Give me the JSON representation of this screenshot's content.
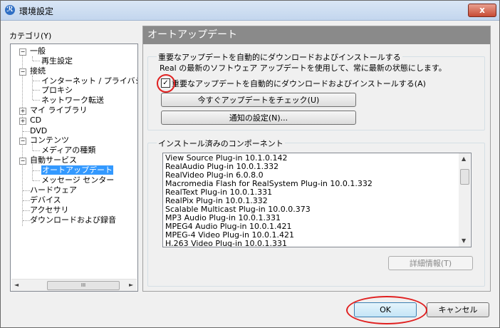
{
  "window": {
    "title": "環境設定",
    "close_label": "x"
  },
  "category_label": "カテゴリ(Y)",
  "tree": [
    {
      "label": "一般",
      "expander": "−"
    },
    {
      "label": "再生設定"
    },
    {
      "label": "接続",
      "expander": "−"
    },
    {
      "label": "インターネット / プライバシー"
    },
    {
      "label": "プロキシ"
    },
    {
      "label": "ネットワーク転送"
    },
    {
      "label": "マイ ライブラリ",
      "expander": "+"
    },
    {
      "label": "CD",
      "expander": "+"
    },
    {
      "label": "DVD"
    },
    {
      "label": "コンテンツ",
      "expander": "−"
    },
    {
      "label": "メディアの種類"
    },
    {
      "label": "自動サービス",
      "expander": "−"
    },
    {
      "label": "オートアップデート"
    },
    {
      "label": "メッセージ センター"
    },
    {
      "label": "ハードウェア"
    },
    {
      "label": "デバイス"
    },
    {
      "label": "アクセサリ"
    },
    {
      "label": "ダウンロードおよび録音"
    }
  ],
  "hscroll": {
    "left": "◄",
    "right": "►",
    "grip": "III"
  },
  "panel": {
    "header": "オートアップデート",
    "update_group": {
      "title": "重要なアップデートを自動的にダウンロードおよびインストールする",
      "description": "Real の最新のソフトウェア アップデートを使用して、常に最新の状態にします。",
      "checkbox_label": "重要なアップデートを自動的にダウンロードおよびインストールする(A)",
      "checkbox_mark": "✓",
      "check_now_button": "今すぐアップデートをチェック(U)",
      "notify_button": "通知の設定(N)..."
    },
    "components_group": {
      "title": "インストール済みのコンポーネント",
      "items": [
        "View Source Plug-in 10.1.0.142",
        "RealAudio Plug-in 10.0.1.332",
        "RealVideo Plug-in 6.0.8.0",
        "Macromedia Flash for RealSystem Plug-in 10.0.1.332",
        "RealText Plug-in 10.0.1.331",
        "RealPix Plug-in 10.0.1.332",
        "Scalable Multicast Plug-in 10.0.0.373",
        "MP3 Audio Plug-in 10.0.1.331",
        "MPEG4 Audio Plug-in 10.0.1.421",
        "MPEG-4 Video Plug-in 10.0.1.421",
        "H.263 Video Plug-in 10.0.1.331"
      ],
      "scroll_up": "▲",
      "scroll_down": "▼",
      "details_button": "詳細情報(T)"
    }
  },
  "footer": {
    "ok_button": "OK",
    "cancel_button": "キャンセル"
  },
  "colors": {
    "selection": "#3399ff",
    "annotation": "#e02020",
    "header": "#8a8a8a"
  }
}
